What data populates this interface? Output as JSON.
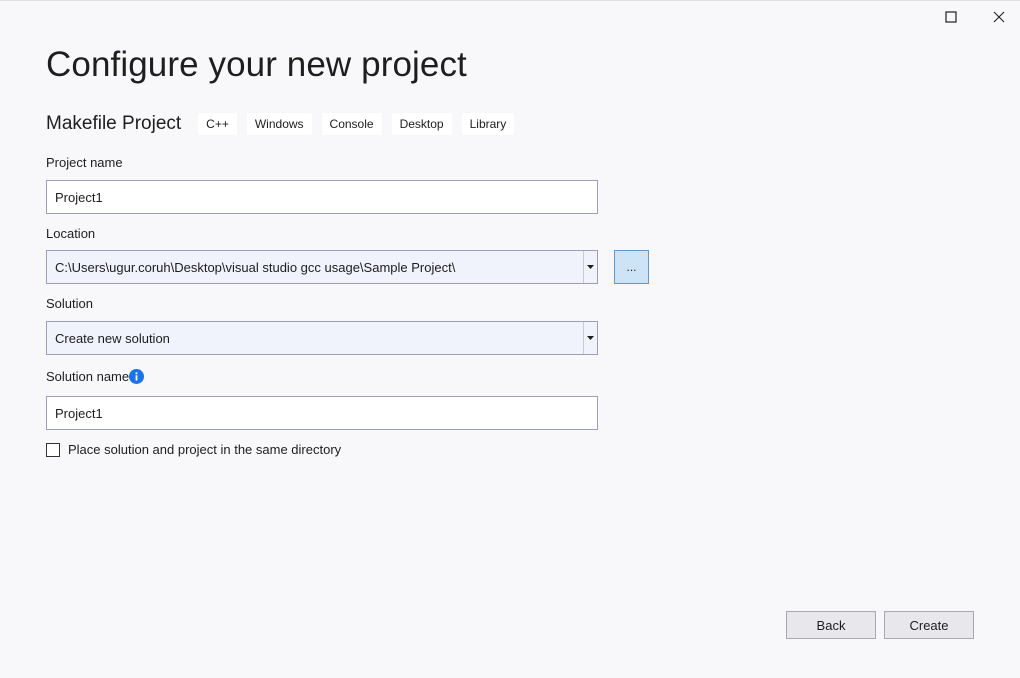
{
  "window": {
    "maximize_icon": "maximize-icon",
    "close_icon": "close-icon"
  },
  "page": {
    "title": "Configure your new project"
  },
  "template": {
    "name": "Makefile Project",
    "tags": [
      "C++",
      "Windows",
      "Console",
      "Desktop",
      "Library"
    ]
  },
  "project_name": {
    "label": "Project name",
    "value": "Project1"
  },
  "location": {
    "label": "Location",
    "value": "C:\\Users\\ugur.coruh\\Desktop\\visual studio gcc usage\\Sample Project\\",
    "browse_label": "..."
  },
  "solution": {
    "label": "Solution",
    "value": "Create new solution"
  },
  "solution_name": {
    "label": "Solution name",
    "value": "Project1",
    "info_icon": "info-icon"
  },
  "same_directory": {
    "label": "Place solution and project in the same directory",
    "checked": false
  },
  "footer": {
    "back_label": "Back",
    "create_label": "Create"
  },
  "colors": {
    "accent": "#1a73e8",
    "browse_bg": "#cde4f7",
    "combo_bg": "#f0f2fc",
    "background": "#f8f8fa"
  }
}
